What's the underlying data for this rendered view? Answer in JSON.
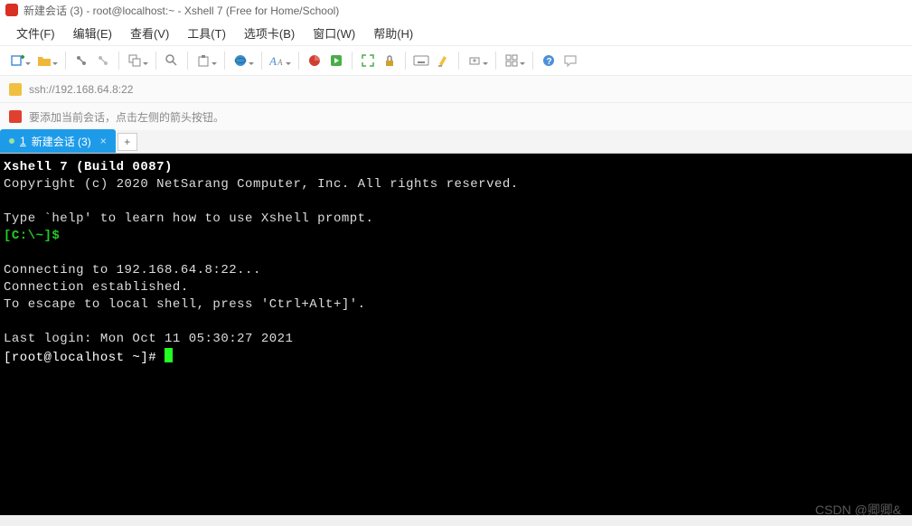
{
  "title": "新建会话 (3) - root@localhost:~ - Xshell 7 (Free for Home/School)",
  "menu": {
    "file": "文件(F)",
    "edit": "编辑(E)",
    "view": "查看(V)",
    "tools": "工具(T)",
    "tabs": "选项卡(B)",
    "window": "窗口(W)",
    "help": "帮助(H)"
  },
  "address": "ssh://192.168.64.8:22",
  "hint": "要添加当前会话，点击左侧的箭头按钮。",
  "tab": {
    "num": "1",
    "label": "新建会话 (3)"
  },
  "addtab": "+",
  "term": {
    "l1": "Xshell 7 (Build 0087)",
    "l2": "Copyright (c) 2020 NetSarang Computer, Inc. All rights reserved.",
    "l3": "",
    "l4": "Type `help' to learn how to use Xshell prompt.",
    "l5": "[C:\\~]$",
    "l6": "",
    "l7": "Connecting to 192.168.64.8:22...",
    "l8": "Connection established.",
    "l9": "To escape to local shell, press 'Ctrl+Alt+]'.",
    "l10": "",
    "l11": "Last login: Mon Oct 11 05:30:27 2021",
    "l12": "[root@localhost ~]# "
  },
  "watermark": "CSDN @卿卿&"
}
